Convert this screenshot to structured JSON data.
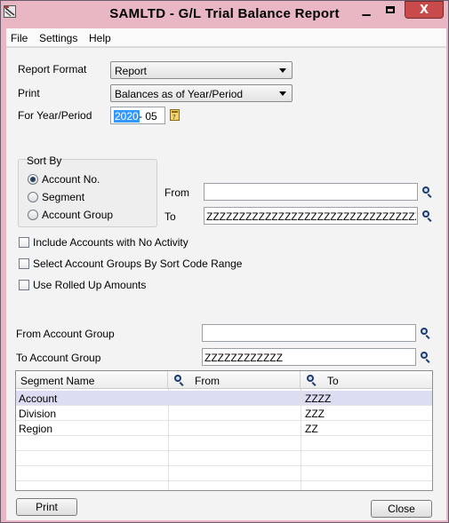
{
  "window": {
    "title": "SAMLTD - G/L Trial Balance Report",
    "minimize_glyph": "▁",
    "close_glyph": "X"
  },
  "menu": [
    "File",
    "Settings",
    "Help"
  ],
  "form": {
    "report_format_label": "Report Format",
    "report_format_value": "Report",
    "print_label": "Print",
    "print_value": "Balances as of Year/Period",
    "year_period_label": "For Year/Period",
    "year_value": "2020",
    "period_value": "- 05"
  },
  "sort_by": {
    "title": "Sort By",
    "options": [
      "Account No.",
      "Segment",
      "Account Group"
    ],
    "selected": "Account No.",
    "from_label": "From",
    "from_value": "",
    "to_label": "To",
    "to_value": "ZZZZZZZZZZZZZZZZZZZZZZZZZZZZZZZZZZZZZZZZZZZZZZ"
  },
  "options": {
    "include_no_activity": "Include Accounts with No Activity",
    "select_groups_by_sort_code": "Select Account Groups By Sort Code Range",
    "use_rolled_up": "Use Rolled Up Amounts"
  },
  "account_group": {
    "from_label": "From Account Group",
    "from_value": "",
    "to_label": "To Account Group",
    "to_value": "ZZZZZZZZZZZZ"
  },
  "grid": {
    "columns": [
      "Segment Name",
      "From",
      "To"
    ],
    "rows": [
      {
        "segment": "Account",
        "from": "",
        "to": "ZZZZ"
      },
      {
        "segment": "Division",
        "from": "",
        "to": "ZZZ"
      },
      {
        "segment": "Region",
        "from": "",
        "to": "ZZ"
      }
    ]
  },
  "buttons": {
    "print": "Print",
    "close": "Close"
  },
  "icons": {
    "app": "app-icon",
    "search": "search-icon",
    "finder": "calendar-finder-icon"
  }
}
